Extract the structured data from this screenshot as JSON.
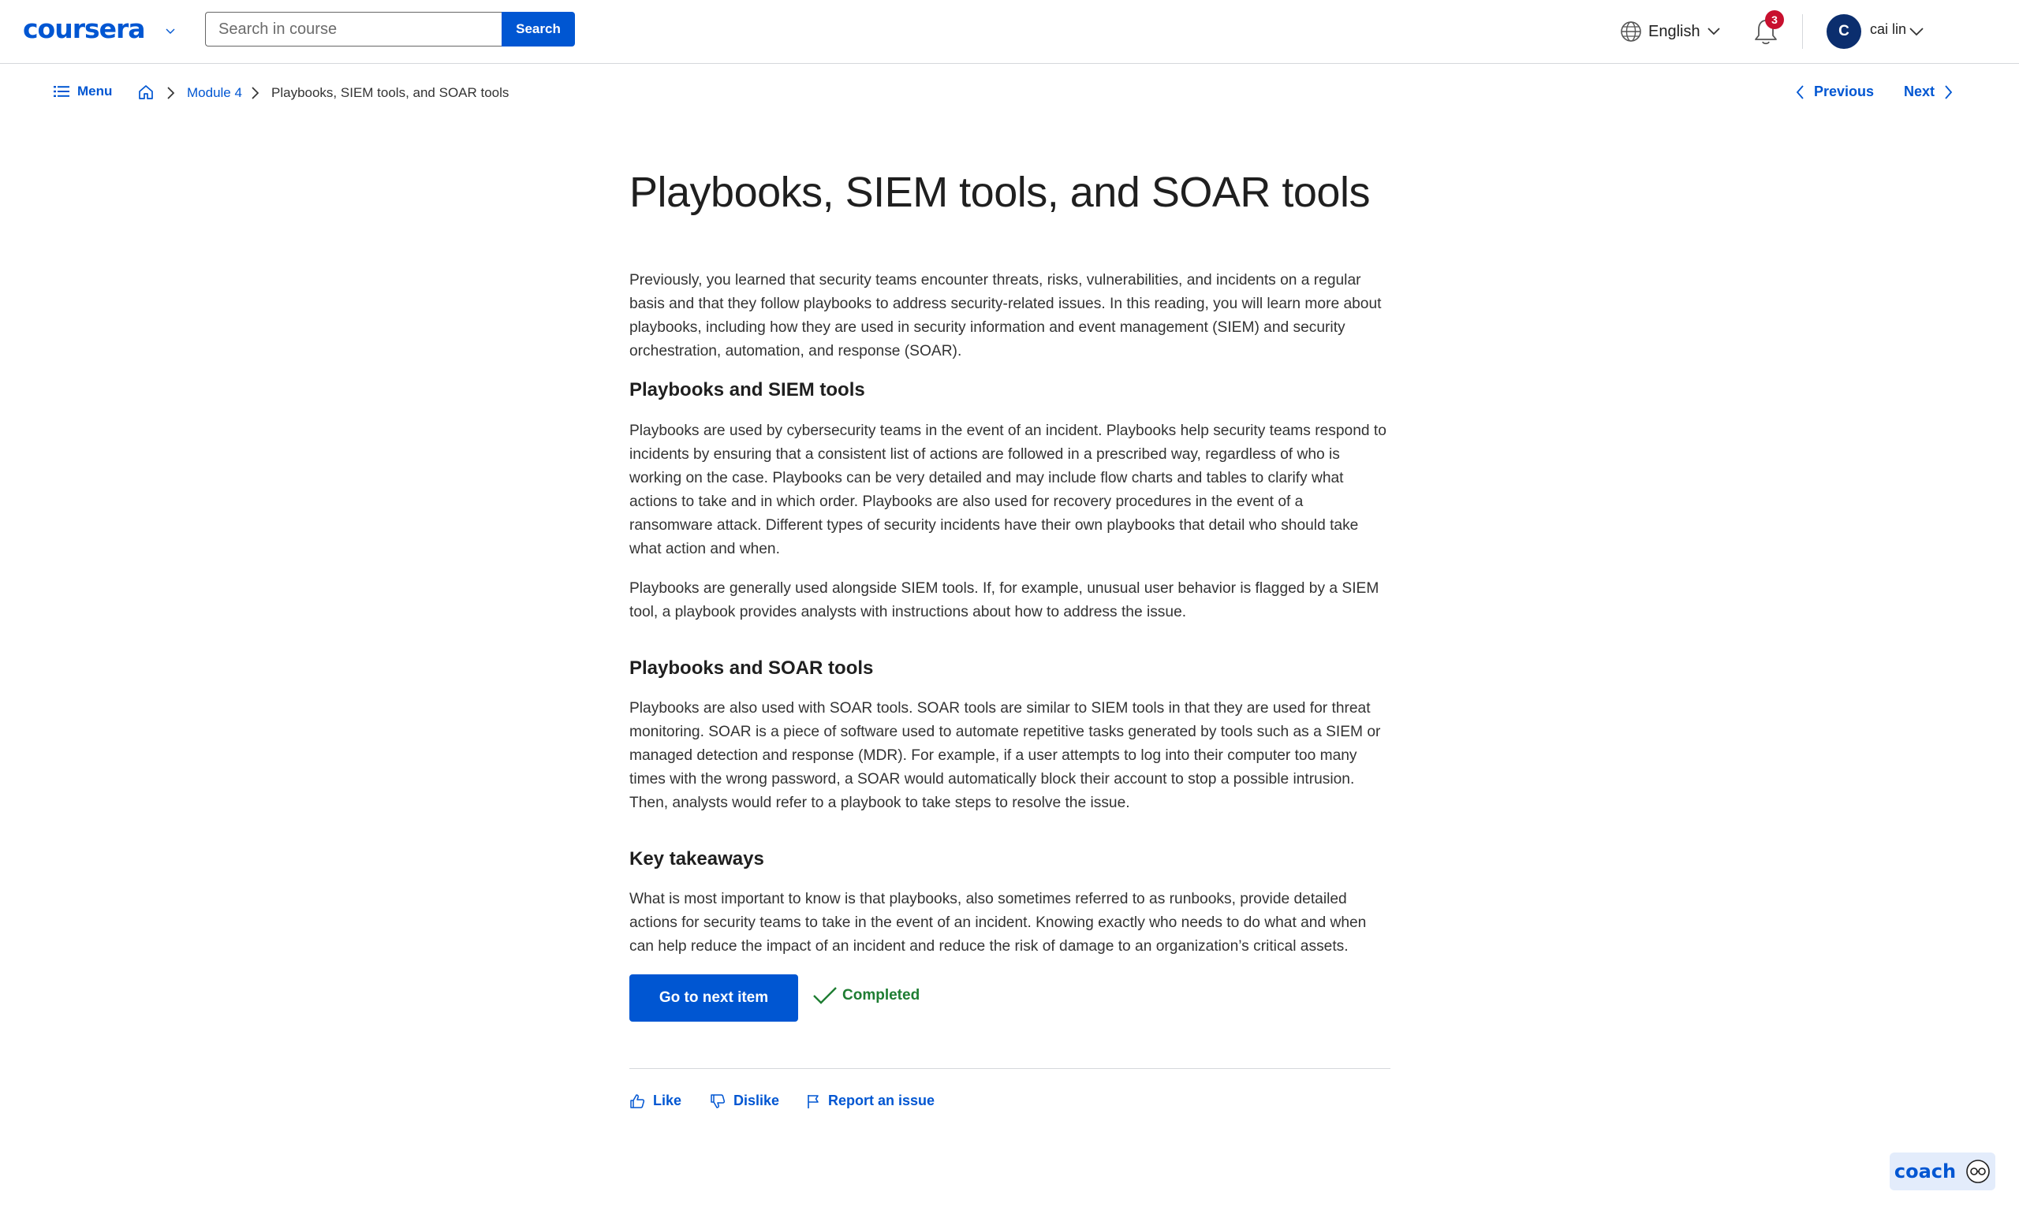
{
  "header": {
    "logo_text": "coursera",
    "search_placeholder": "Search in course",
    "search_button": "Search",
    "language": "English",
    "notification_count": "3",
    "avatar_initial": "C",
    "username": "cai lin"
  },
  "subnav": {
    "menu_label": "Menu",
    "breadcrumb_module": "Module 4",
    "breadcrumb_current": "Playbooks, SIEM tools, and SOAR tools",
    "previous_label": "Previous",
    "next_label": "Next"
  },
  "article": {
    "title": "Playbooks, SIEM tools, and SOAR tools",
    "intro": "Previously, you learned that security teams encounter threats, risks, vulnerabilities, and incidents on a regular basis and that they follow playbooks to address security-related issues. In this reading, you will learn more about playbooks, including how they are used in security information and event management (SIEM) and security orchestration, automation, and response (SOAR).",
    "section1_heading": "Playbooks and SIEM tools",
    "section1_p1": "Playbooks are used by cybersecurity teams in the event of an incident. Playbooks help security teams respond to incidents by ensuring that a consistent list of actions are followed in a prescribed way, regardless of who is working on the case. Playbooks can be very detailed and may include flow charts and tables to clarify what actions to take and in which order. Playbooks are also used for recovery procedures in the event of a ransomware attack. Different types of security incidents have their own playbooks that detail who should take what action and when.",
    "section1_p2": "Playbooks are generally used alongside SIEM tools. If, for example, unusual user behavior is flagged by a SIEM tool, a playbook provides analysts with instructions about how to address the issue.",
    "section2_heading": "Playbooks and SOAR tools",
    "section2_p1": "Playbooks are also used with SOAR tools. SOAR tools are similar to SIEM tools in that they are used for threat monitoring. SOAR is a piece of software used to automate repetitive tasks generated by tools such as a SIEM or managed detection and response (MDR). For example, if a user attempts to log into their computer too many times with the wrong password, a SOAR would automatically block their account to stop a possible intrusion. Then, analysts would refer to a playbook to take steps to resolve the issue.",
    "section3_heading": "Key takeaways",
    "section3_p1": "What is most important to know is that playbooks, also sometimes referred to as runbooks, provide detailed actions for security teams to take in the event of an incident. Knowing exactly who needs to do what and when can help reduce the impact of an incident and reduce the risk of damage to an organization’s critical assets."
  },
  "actions": {
    "next_item_button": "Go to next item",
    "completed_label": "Completed",
    "like_label": "Like",
    "dislike_label": "Dislike",
    "report_label": "Report an issue"
  },
  "coach": {
    "label": "coach"
  },
  "colors": {
    "brand_blue": "#0056d2",
    "completed_green": "#1e7d32",
    "badge_red": "#c8102e",
    "avatar_navy": "#0b2e6e"
  }
}
